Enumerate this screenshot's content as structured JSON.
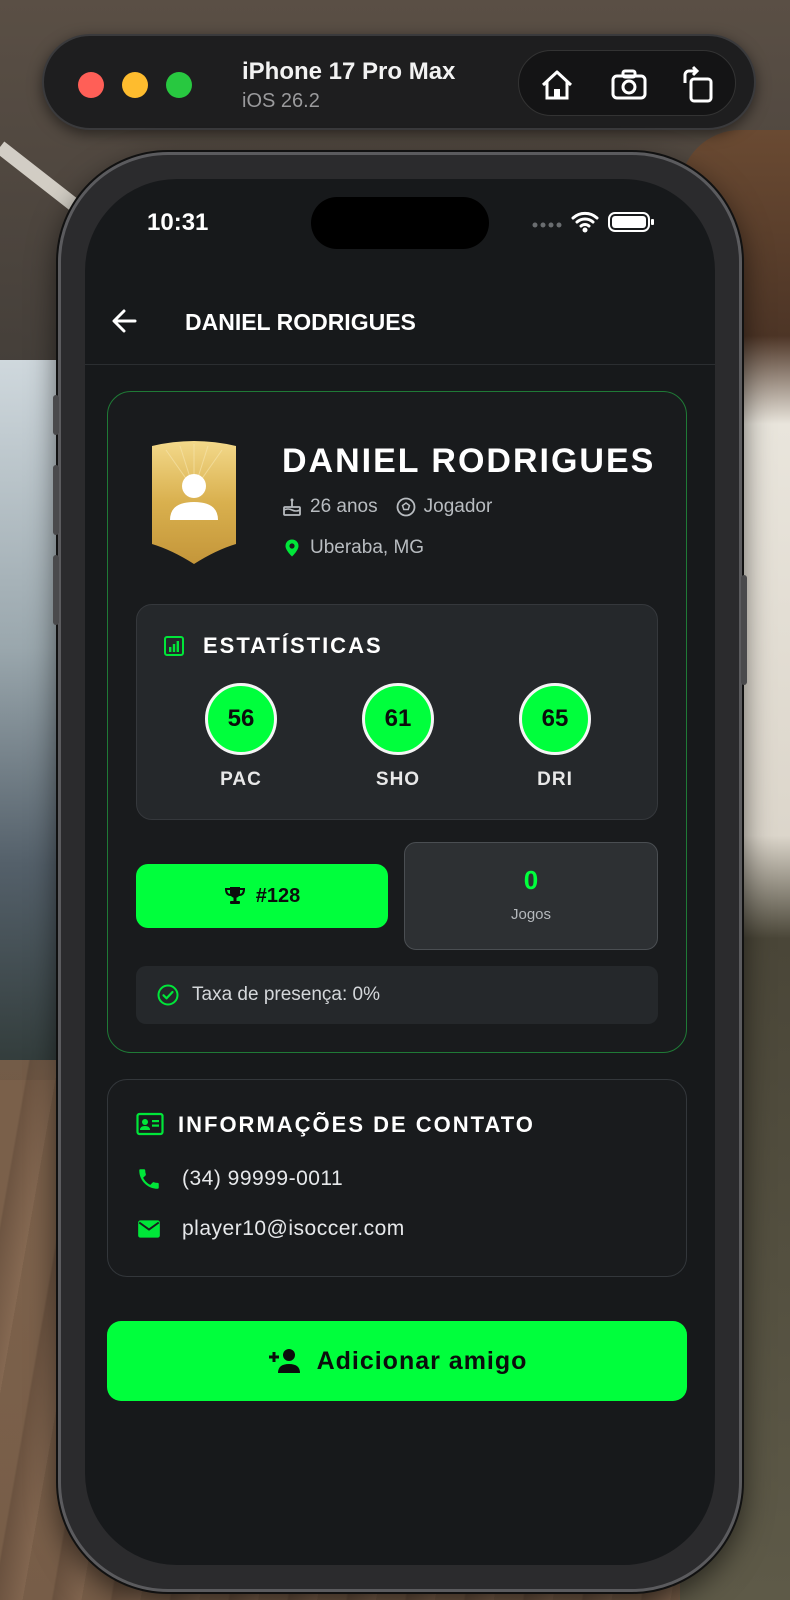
{
  "simulator": {
    "device_name": "iPhone 17 Pro Max",
    "os_version": "iOS 26.2",
    "tools": [
      "home-icon",
      "screenshot-icon",
      "rotate-icon"
    ]
  },
  "status_bar": {
    "time": "10:31"
  },
  "app_bar": {
    "title": "DANIEL RODRIGUES"
  },
  "profile": {
    "name": "DANIEL RODRIGUES",
    "age": "26 anos",
    "role": "Jogador",
    "location": "Uberaba, MG"
  },
  "stats": {
    "title": "ESTATÍSTICAS",
    "items": [
      {
        "value": "56",
        "label": "PAC"
      },
      {
        "value": "61",
        "label": "SHO"
      },
      {
        "value": "65",
        "label": "DRI"
      }
    ]
  },
  "ranking": {
    "label": "#128"
  },
  "games": {
    "value": "0",
    "label": "Jogos"
  },
  "presence": {
    "text": "Taxa de presença: 0%"
  },
  "contact": {
    "title": "INFORMAÇÕES DE CONTATO",
    "phone": "(34) 99999-0011",
    "email": "player10@isoccer.com"
  },
  "actions": {
    "add_friend": "Adicionar amigo"
  },
  "colors": {
    "accent": "#00ff3c",
    "background": "#17191b",
    "card_border": "#1f7a36",
    "badge_gold": "#d9b04e"
  }
}
